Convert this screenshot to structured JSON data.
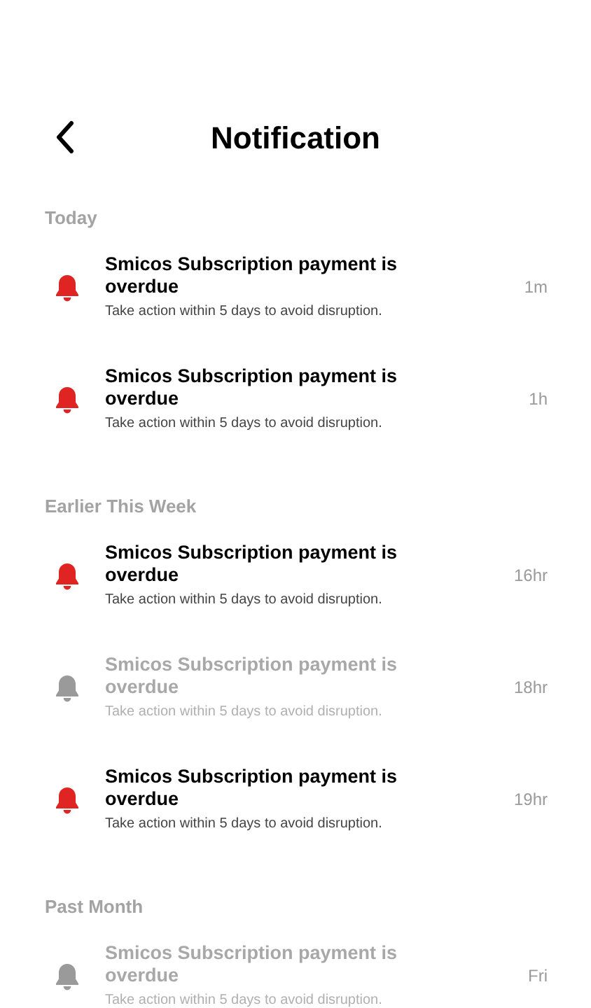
{
  "header": {
    "title": "Notification"
  },
  "sections": [
    {
      "label": "Today",
      "items": [
        {
          "title": "Smicos Subscription payment is overdue",
          "message": "Take action within 5 days to avoid disruption.",
          "time": "1m",
          "unread": true
        },
        {
          "title": "Smicos Subscription payment is overdue",
          "message": "Take action within 5 days to avoid disruption.",
          "time": "1h",
          "unread": true
        }
      ]
    },
    {
      "label": "Earlier This Week",
      "items": [
        {
          "title": "Smicos Subscription payment is overdue",
          "message": "Take action within 5 days to avoid disruption.",
          "time": "16hr",
          "unread": true
        },
        {
          "title": "Smicos Subscription payment is overdue",
          "message": "Take action within 5 days to avoid disruption.",
          "time": "18hr",
          "unread": false
        },
        {
          "title": "Smicos Subscription payment is overdue",
          "message": "Take action within 5 days to avoid disruption.",
          "time": "19hr",
          "unread": true
        }
      ]
    },
    {
      "label": "Past Month",
      "items": [
        {
          "title": "Smicos Subscription payment is overdue",
          "message": "Take action within 5 days to avoid disruption.",
          "time": "Fri",
          "unread": false
        }
      ]
    }
  ]
}
